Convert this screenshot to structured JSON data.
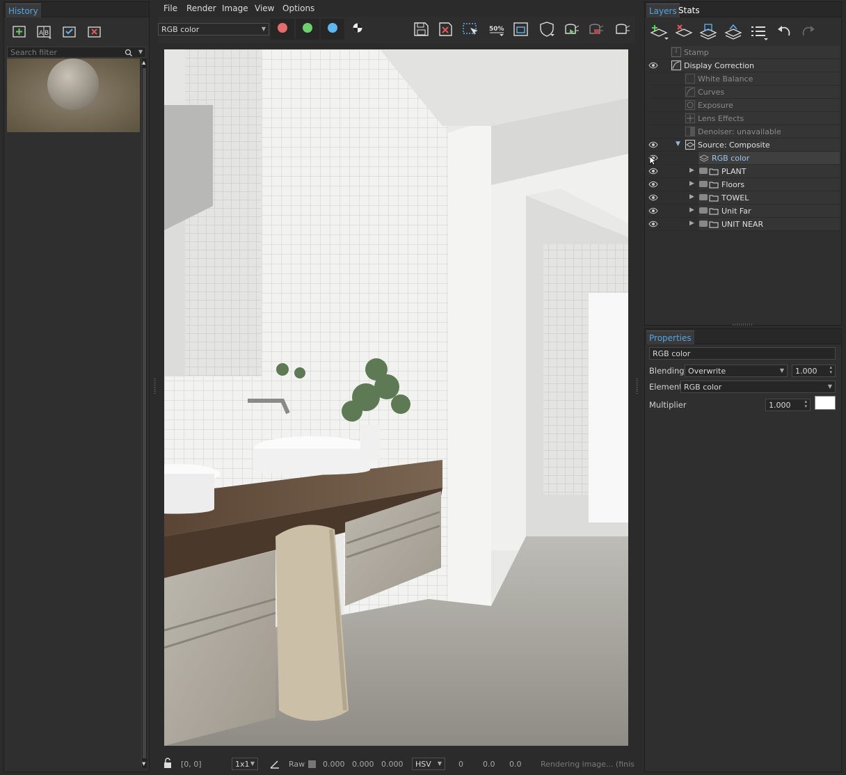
{
  "history": {
    "tab_label": "History",
    "search_placeholder": "Search filter"
  },
  "menubar": {
    "items": [
      "File",
      "Render",
      "Image",
      "View",
      "Options"
    ]
  },
  "toolbar": {
    "channel_select": "RGB color",
    "zoom_label": "50%",
    "channel_colors": {
      "red": "#e86c6c",
      "green": "#6cd06c",
      "blue": "#5cb8f0"
    }
  },
  "statusbar": {
    "coords": "[0, 0]",
    "sampler": "1x1",
    "raw_label": "Raw",
    "r": "0.000",
    "g": "0.000",
    "b": "0.000",
    "color_mode": "HSV",
    "h": "0",
    "s": "0.0",
    "v": "0.0",
    "status": "Rendering image... (finis"
  },
  "layers": {
    "tabs": [
      "Layers",
      "Stats"
    ],
    "rows": [
      {
        "label": "Stamp"
      },
      {
        "label": "Display Correction"
      },
      {
        "label": "White Balance"
      },
      {
        "label": "Curves"
      },
      {
        "label": "Exposure"
      },
      {
        "label": "Lens Effects"
      },
      {
        "label": "Denoiser: unavailable"
      },
      {
        "label": "Source: Composite"
      },
      {
        "label": "RGB color"
      },
      {
        "label": "PLANT"
      },
      {
        "label": "Floors"
      },
      {
        "label": "TOWEL"
      },
      {
        "label": "Unit Far"
      },
      {
        "label": "UNIT NEAR"
      }
    ]
  },
  "properties": {
    "tab_label": "Properties",
    "name_value": "RGB color",
    "blending_label": "Blending",
    "blending_value": "Overwrite",
    "opacity_value": "1.000",
    "element_label": "Element",
    "element_value": "RGB color",
    "multiplier_label": "Multiplier",
    "multiplier_value": "1.000",
    "multiplier_color": "#ffffff"
  }
}
